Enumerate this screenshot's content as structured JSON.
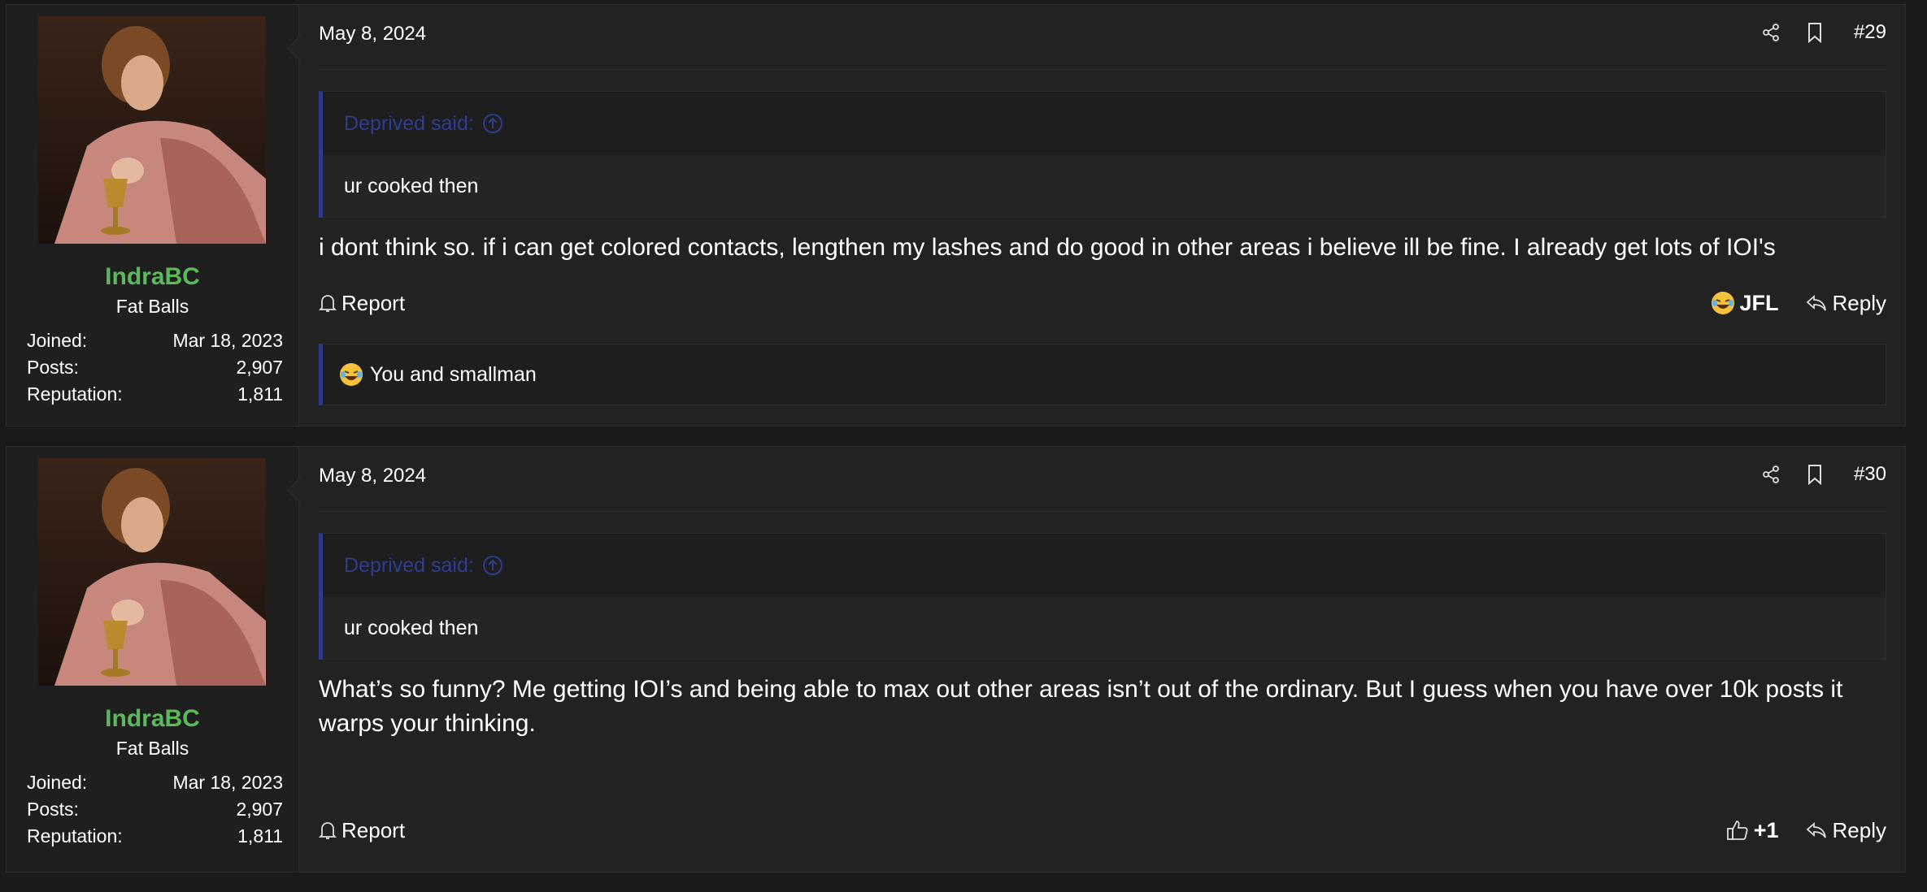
{
  "posts": [
    {
      "user": {
        "name": "IndraBC",
        "title": "Fat Balls",
        "stats": [
          {
            "label": "Joined:",
            "value": "Mar 18, 2023"
          },
          {
            "label": "Posts:",
            "value": "2,907"
          },
          {
            "label": "Reputation:",
            "value": "1,811"
          }
        ]
      },
      "date": "May 8, 2024",
      "number": "#29",
      "quote": {
        "author": "Deprived said:",
        "text": "ur cooked then"
      },
      "message": "i dont think so. if i can get colored contacts, lengthen my lashes and do good in other areas i believe ill be fine. I already get lots of IOI's",
      "report_label": "Report",
      "reaction_label": "JFL",
      "reply_label": "Reply",
      "reaction_summary": "You and smallman"
    },
    {
      "user": {
        "name": "IndraBC",
        "title": "Fat Balls",
        "stats": [
          {
            "label": "Joined:",
            "value": "Mar 18, 2023"
          },
          {
            "label": "Posts:",
            "value": "2,907"
          },
          {
            "label": "Reputation:",
            "value": "1,811"
          }
        ]
      },
      "date": "May 8, 2024",
      "number": "#30",
      "quote": {
        "author": "Deprived said:",
        "text": "ur cooked then"
      },
      "message": "What’s so funny? Me getting IOI’s and being able to max out other areas isn’t out of the ordinary. But I guess when you have over 10k posts it warps your thinking.",
      "report_label": "Report",
      "reaction_label": "+1",
      "reply_label": "Reply"
    }
  ],
  "icons": {
    "share": "share-icon",
    "bookmark": "bookmark-icon",
    "bell": "bell-icon",
    "reply": "reply-arrow-icon",
    "thumb": "thumbs-up-icon",
    "laugh": "laughing-emoji-icon",
    "quote_up": "arrow-up-circle-icon"
  },
  "colors": {
    "background": "#1a1a1a",
    "post": "#222222",
    "username": "#5cb85c",
    "quote_accent": "#2f3a8f"
  }
}
